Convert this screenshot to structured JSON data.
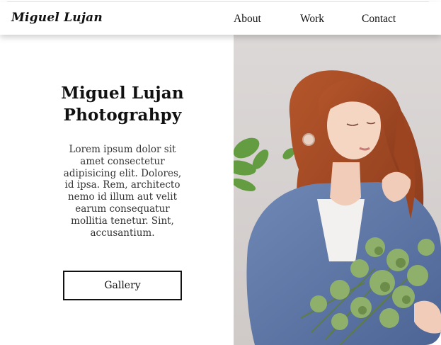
{
  "header": {
    "logo": "Miguel Lujan",
    "nav": [
      "About",
      "Work",
      "Contact"
    ]
  },
  "hero": {
    "title_line1": "Miguel Lujan",
    "title_line2": "Photograhpy",
    "description": "Lorem ipsum dolor sit amet consectetur adipisicing elit. Dolores, id ipsa. Rem, architecto nemo id illum aut velit earum consequatur mollitia tenetur. Sint, accusantium.",
    "button_label": "Gallery"
  }
}
